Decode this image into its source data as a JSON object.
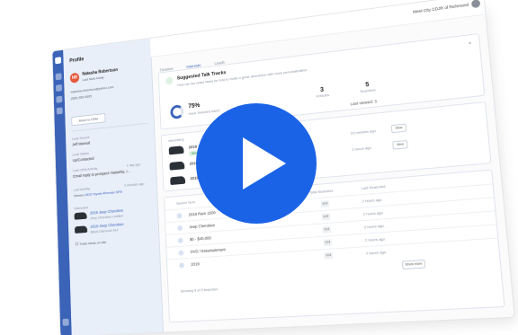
{
  "sidebar": {
    "title": "Profile",
    "contact": {
      "initials": "NR",
      "name": "Natasha Robertson",
      "subtitle": "Last Note today",
      "email": "natasha.robertson@yahoo.com",
      "phone": "(555) 555-5555",
      "button": "Move to CRM"
    },
    "fields": [
      {
        "label": "Lead Source",
        "value": "Jeff Manual"
      },
      {
        "label": "Lead Status",
        "value": "Up/Contacted"
      },
      {
        "label": "Last CRM Activity",
        "value": "Email reply to prospect: Natasha, I...",
        "meta": "1 day ago"
      }
    ],
    "last_activity_label": "Last Activity",
    "last_activity_meta": "3 minutes ago",
    "last_activity_value": "Viewed",
    "last_activity_link": "2020 Toyota 4Runner SR5",
    "interests_label": "Interested",
    "interests": [
      {
        "name": "2019 Jeep Cherokee",
        "detail": "Jeep Cherokee Limited"
      },
      {
        "name": "2019 Jeep Cherokee",
        "detail": "Black Diamond 4x4"
      }
    ],
    "checkbox_label": "Trade ideas on site"
  },
  "header": {
    "template": "Meet City CDJR of Richmond"
  },
  "tabs": [
    {
      "label": "Timeline",
      "active": false
    },
    {
      "label": "Interests",
      "active": true
    },
    {
      "label": "Leads",
      "active": false
    }
  ],
  "suggested": {
    "title": "Suggested Talk Tracks",
    "description": "How can we make ideas for how to make a great discussion with more personalization"
  },
  "stats": {
    "percent": "75%",
    "percent_label": "Have Selected Intent",
    "items": [
      {
        "value": "3",
        "label": "Vehicles"
      },
      {
        "value": "5",
        "label": "Searches"
      }
    ],
    "last_viewed": "Last viewed: 3"
  },
  "vehicles": {
    "section_label": "Interesting",
    "rows": [
      {
        "name": "2019 Jeep Cherokee",
        "badge": "Most Viewed",
        "age": "23 minutes ago",
        "action": "View"
      },
      {
        "name": "2019 Jeep Cherokee",
        "age": "2 hours ago",
        "action": "View"
      },
      {
        "name": "2019 Jeep Cherokee"
      }
    ]
  },
  "searches": {
    "col_search": "Search Term",
    "col_count": "Total Searches",
    "col_last": "Last Searched",
    "rows": [
      {
        "term": "2019 Ram 1500",
        "count": "x14",
        "age": "2 hours ago"
      },
      {
        "term": "Jeep Cherokee",
        "count": "x14",
        "age": "2 hours ago"
      },
      {
        "term": "$0 - $40,000",
        "count": "x14",
        "age": "2 hours ago"
      },
      {
        "term": "DVD / Entertainment",
        "count": "x14",
        "age": "2 hours ago"
      },
      {
        "term": "2019",
        "count": "x14",
        "age": "2 hours ago"
      }
    ],
    "footer": "Showing 5 of 5 searches",
    "more_button": "Show more"
  },
  "colors": {
    "brand": "#3b63b8",
    "play": "#1b63e6",
    "avatar": "#e55a3c"
  },
  "overlay": {
    "icon": "play-icon"
  }
}
